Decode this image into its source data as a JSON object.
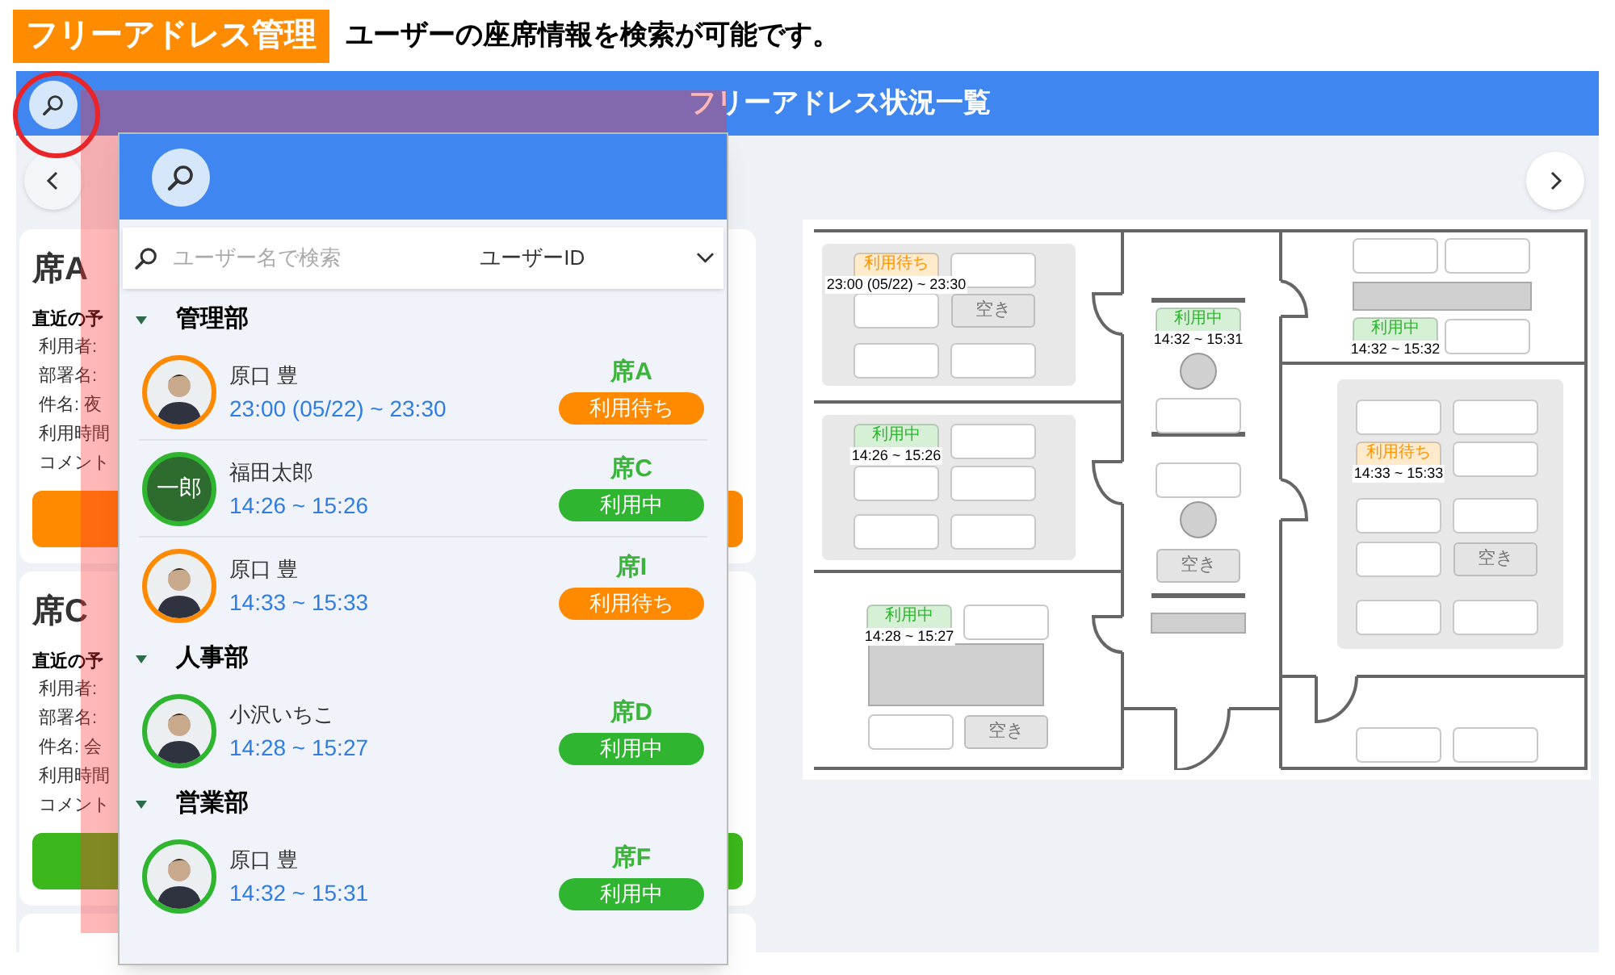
{
  "banner": {
    "tag": "フリーアドレス管理",
    "caption": "ユーザーの座席情報を検索が可能です。"
  },
  "app": {
    "title": "フリーアドレス状況一覧"
  },
  "cards": [
    {
      "seat": "席A",
      "heading": "直近の予",
      "fields": [
        "利用者:",
        "部署名:",
        "件名: 夜",
        "利用時間",
        "コメント"
      ],
      "color": "#ff8a00"
    },
    {
      "seat": "席C",
      "heading": "直近の予",
      "fields": [
        "利用者:",
        "部署名:",
        "件名: 会",
        "利用時間",
        "コメント"
      ],
      "color": "#3cb81c"
    }
  ],
  "search_panel": {
    "placeholder": "ユーザー名で検索",
    "filter": "ユーザーID",
    "groups": [
      {
        "name": "管理部",
        "expanded": true,
        "members": [
          {
            "name": "原口 豊",
            "time": "23:00 (05/22) ~ 23:30",
            "seat": "席A",
            "color": "#ff8a00",
            "status_label": "利用待ち",
            "avatar": {
              "kind": "photo"
            }
          },
          {
            "name": "福田太郎",
            "time": "14:26 ~ 15:26",
            "seat": "席C",
            "color": "#2fb52f",
            "status_label": "利用中",
            "avatar": {
              "kind": "initials",
              "text": "一郎"
            }
          },
          {
            "name": "原口 豊",
            "time": "14:33 ~ 15:33",
            "seat": "席I",
            "color": "#ff8a00",
            "status_label": "利用待ち",
            "avatar": {
              "kind": "photo"
            }
          }
        ]
      },
      {
        "name": "人事部",
        "expanded": true,
        "members": [
          {
            "name": "小沢いちこ",
            "time": "14:28 ~ 15:27",
            "seat": "席D",
            "color": "#2fb52f",
            "status_label": "利用中",
            "avatar": {
              "kind": "photo"
            }
          }
        ]
      },
      {
        "name": "営業部",
        "expanded": true,
        "members": [
          {
            "name": "原口 豊",
            "time": "14:32 ~ 15:31",
            "seat": "席F",
            "color": "#2fb52f",
            "status_label": "利用中",
            "avatar": {
              "kind": "photo"
            }
          }
        ]
      }
    ]
  },
  "floor_plan": {
    "markers": [
      {
        "kind": "occupied",
        "color": "#ff9500",
        "label": "利用待ち",
        "time": "23:00 (05/22) ~ 23:30"
      },
      {
        "kind": "vacant",
        "label": "空き"
      },
      {
        "kind": "occupied",
        "color": "#2fb52f",
        "label": "利用中",
        "time": "14:32 ~ 15:31"
      },
      {
        "kind": "occupied",
        "color": "#2fb52f",
        "label": "利用中",
        "time": "14:32 ~ 15:32"
      },
      {
        "kind": "occupied",
        "color": "#2fb52f",
        "label": "利用中",
        "time": "14:26 ~ 15:26"
      },
      {
        "kind": "occupied",
        "color": "#ff9500",
        "label": "利用待ち",
        "time": "14:33 ~ 15:33"
      },
      {
        "kind": "vacant",
        "label": "空き"
      },
      {
        "kind": "vacant",
        "label": "空き"
      },
      {
        "kind": "occupied",
        "color": "#2fb52f",
        "label": "利用中",
        "time": "14:28 ~ 15:27"
      },
      {
        "kind": "vacant",
        "label": "空き"
      }
    ]
  }
}
